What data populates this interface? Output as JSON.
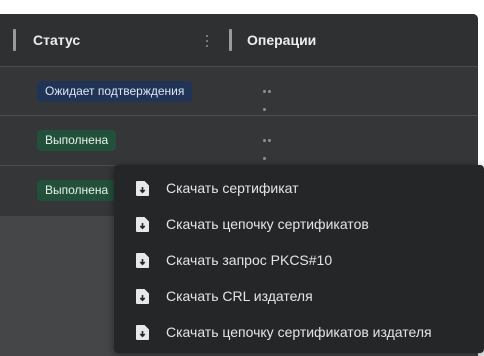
{
  "table": {
    "columns": {
      "status": "Статус",
      "operations": "Операции"
    },
    "rows": [
      {
        "status": "Ожидает подтверждения",
        "status_kind": "pending"
      },
      {
        "status": "Выполнена",
        "status_kind": "done"
      },
      {
        "status": "Выполнена",
        "status_kind": "done"
      }
    ],
    "row_actions_icon": "more-horizontal-icon",
    "column_menu_icon": "more-vertical-icon"
  },
  "menu": {
    "items": [
      {
        "label": "Скачать сертификат",
        "icon": "file-download-icon"
      },
      {
        "label": "Скачать цепочку сертификатов",
        "icon": "file-download-icon"
      },
      {
        "label": "Скачать запрос PKCS#10",
        "icon": "file-download-icon"
      },
      {
        "label": "Скачать CRL издателя",
        "icon": "file-download-icon"
      },
      {
        "label": "Скачать цепочку сертификатов издателя",
        "icon": "file-download-icon"
      }
    ]
  },
  "colors": {
    "header_bg": "#2f3032",
    "row_bg": "#353638",
    "menu_bg": "#252628",
    "badge_pending_bg": "#213456",
    "badge_done_bg": "#22503a"
  }
}
